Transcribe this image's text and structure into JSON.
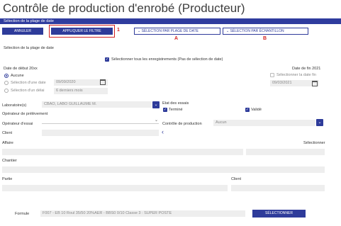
{
  "page": {
    "title": "Contrôle de production d'enrobé (Producteur)"
  },
  "bar": {
    "label": "Sélection de la plage de date"
  },
  "toolbar": {
    "annuler": "ANNULER",
    "appliquer": "APPLIQUER LE FILTRE",
    "marker1": "1",
    "plage": "SÉLECTION PAR PLAGE DE DATE",
    "echantillon": "SÉLECTION PAR ÉCHANTILLON",
    "markerA": "A",
    "markerB": "B"
  },
  "section": {
    "title": "Sélection de la plage de date",
    "select_all": "Sélectionner tous les enregistrements (Pas de sélection de date)"
  },
  "dates": {
    "start_label": "Date de début 20xx",
    "end_label": "Date de fin 2021",
    "aucune": "Aucune",
    "une_date": "Sélection d'une date",
    "start_value": "09/09/2020",
    "delai": "Sélection d'un délai",
    "delai_value": "6 derniers mois",
    "end_checkbox": "Sélectionner la date fin",
    "end_value": "09/03/2021"
  },
  "filters": {
    "laboratoire_label": "Laboratoire(s)",
    "laboratoire_value": "CBAO, LABO GUILLAUME M.",
    "etat_label": "Etat des essais",
    "termine": "Terminé",
    "valide": "Validé",
    "operateur_prelevement": "Opérateur de prélèvement",
    "operateur_essai": "Opérateur d'essai",
    "controle_label": "Contrôle de production",
    "controle_value": "Aucun",
    "client": "Client",
    "affaire": "Affaire",
    "selectionner_link": "Sélectionner",
    "chantier": "Chantier",
    "partie": "Partie",
    "client2": "Client"
  },
  "formule": {
    "label": "Formule",
    "value": "F007 - EB 10 Roul 35/50 20%AER - BBS0 0/10 Classe 3 : SUPER POSTE",
    "button": "SÉLECTIONNER"
  },
  "colors": {
    "accent": "#2e3b9a",
    "marker": "#d32020",
    "field": "#eeeeee"
  }
}
